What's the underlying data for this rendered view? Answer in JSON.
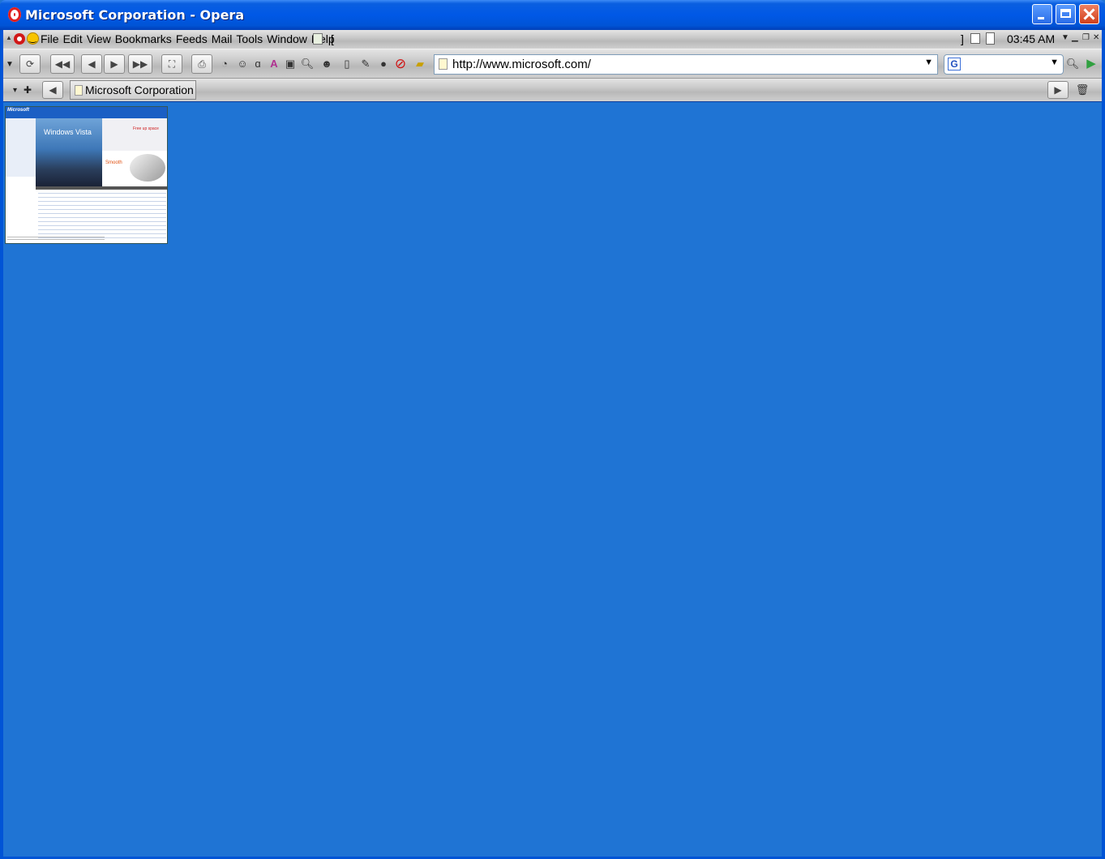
{
  "window": {
    "title": "Microsoft Corporation - Opera"
  },
  "menubar": {
    "items": [
      "File",
      "Edit",
      "View",
      "Bookmarks",
      "Feeds",
      "Mail",
      "Tools",
      "Window",
      "Help"
    ],
    "bracket_left": "[",
    "bracket_right": "]",
    "clock": "03:45 AM"
  },
  "toolbar": {
    "address_url": "http://www.microsoft.com/",
    "search_engine_icon": "G",
    "search_value": ""
  },
  "tabs": [
    {
      "label": "Microsoft Corporation",
      "active": true
    }
  ],
  "thumbnail": {
    "logo": "Microsoft",
    "hero_text": "Windows Vista",
    "promo_1": "Free up space",
    "promo_2": "Smooth"
  },
  "colors": {
    "desktop_blue": "#1f74d4",
    "titlebar_blue": "#0058e6",
    "close_red": "#d0401c"
  }
}
